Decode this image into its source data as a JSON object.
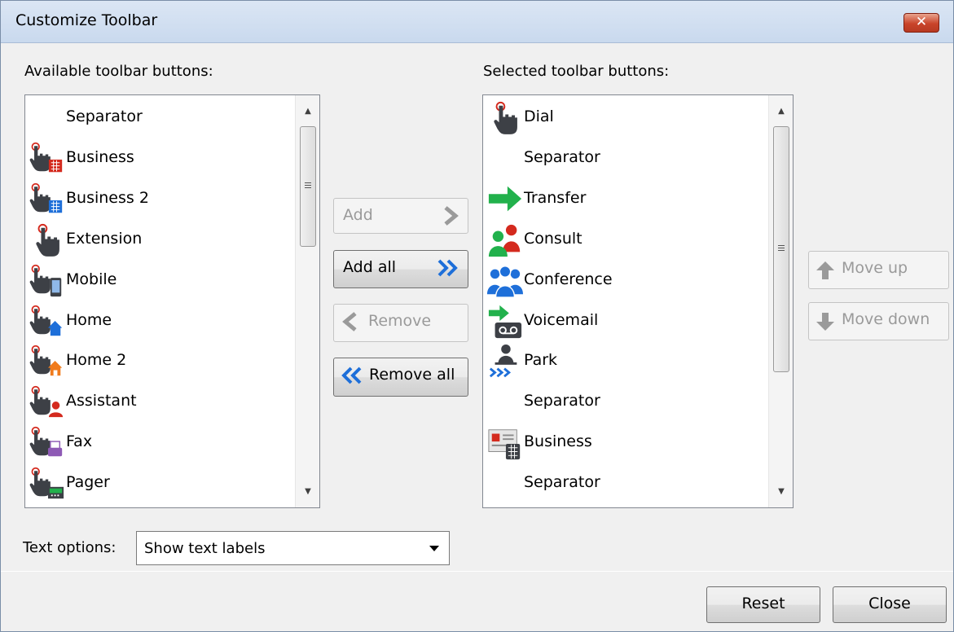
{
  "window": {
    "title": "Customize Toolbar",
    "close_glyph": "✕"
  },
  "available": {
    "label": "Available toolbar buttons:",
    "items": [
      {
        "label": "Separator",
        "icon": "none"
      },
      {
        "label": "Business",
        "icon": "hand-business-icon"
      },
      {
        "label": "Business 2",
        "icon": "hand-business2-icon"
      },
      {
        "label": "Extension",
        "icon": "hand-icon"
      },
      {
        "label": "Mobile",
        "icon": "hand-mobile-icon"
      },
      {
        "label": "Home",
        "icon": "hand-home-icon"
      },
      {
        "label": "Home 2",
        "icon": "hand-home2-icon"
      },
      {
        "label": "Assistant",
        "icon": "hand-assistant-icon"
      },
      {
        "label": "Fax",
        "icon": "hand-fax-icon"
      },
      {
        "label": "Pager",
        "icon": "hand-pager-icon"
      }
    ]
  },
  "selected": {
    "label": "Selected toolbar buttons:",
    "items": [
      {
        "label": "Dial",
        "icon": "hand-icon"
      },
      {
        "label": "Separator",
        "icon": "none"
      },
      {
        "label": "Transfer",
        "icon": "green-arrow-icon"
      },
      {
        "label": "Consult",
        "icon": "consult-people-icon"
      },
      {
        "label": "Conference",
        "icon": "conference-people-icon"
      },
      {
        "label": "Voicemail",
        "icon": "voicemail-icon"
      },
      {
        "label": "Park",
        "icon": "park-icon"
      },
      {
        "label": "Separator",
        "icon": "none"
      },
      {
        "label": "Business",
        "icon": "contact-card-business-icon"
      },
      {
        "label": "Separator",
        "icon": "none"
      }
    ]
  },
  "buttons": {
    "add": "Add",
    "add_all": "Add all",
    "remove": "Remove",
    "remove_all": "Remove all",
    "move_up": "Move up",
    "move_down": "Move down",
    "reset": "Reset",
    "close": "Close"
  },
  "text_options": {
    "label": "Text options:",
    "value": "Show text labels"
  },
  "colors": {
    "hand": "#3d4046",
    "red": "#d42a1e",
    "blue": "#1e6fd9",
    "green": "#22b14c",
    "orange": "#f07b1c",
    "purple": "#8e5ab5"
  }
}
